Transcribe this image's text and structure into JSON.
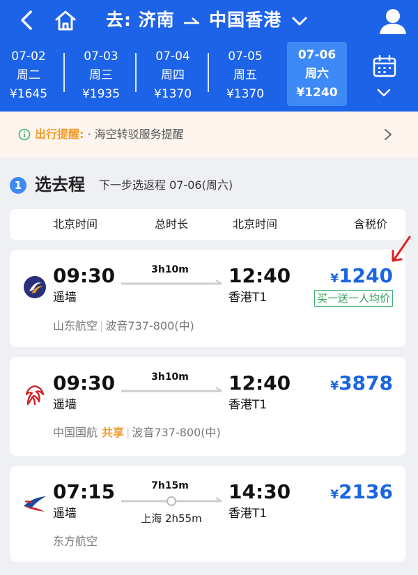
{
  "header": {
    "title_prefix": "去:",
    "origin": "济南",
    "destination": "中国香港",
    "colors": {
      "bg": "#1d63e8",
      "active_date": "#3d8af7"
    }
  },
  "dates": [
    {
      "date": "07-02",
      "weekday": "周二",
      "price": "¥1645",
      "active": false
    },
    {
      "date": "07-03",
      "weekday": "周三",
      "price": "¥1935",
      "active": false
    },
    {
      "date": "07-04",
      "weekday": "周四",
      "price": "¥1370",
      "active": false
    },
    {
      "date": "07-05",
      "weekday": "周五",
      "price": "¥1370",
      "active": false
    },
    {
      "date": "07-06",
      "weekday": "周六",
      "price": "¥1240",
      "active": true
    }
  ],
  "notice": {
    "label": "出行提醒:",
    "text": "· 海空转驳服务提醒"
  },
  "step": {
    "number": "1",
    "title": "选去程",
    "subtitle": "下一步选返程 07-06(周六)"
  },
  "columns": {
    "dep": "北京时间",
    "duration": "总时长",
    "arr": "北京时间",
    "price": "含税价"
  },
  "flights": [
    {
      "dep_time": "09:30",
      "dep_airport": "遥墙",
      "duration": "3h10m",
      "arr_time": "12:40",
      "arr_airport": "香港T1",
      "currency": "¥",
      "price": "1240",
      "tag": "买一送一人均价",
      "airline": "山东航空",
      "aircraft": "波音737-800(中)",
      "logo": "shandong-airlines-logo"
    },
    {
      "dep_time": "09:30",
      "dep_airport": "遥墙",
      "duration": "3h10m",
      "arr_time": "12:40",
      "arr_airport": "香港T1",
      "currency": "¥",
      "price": "3878",
      "airline": "中国国航",
      "share": "共享",
      "aircraft": "波音737-800(中)",
      "logo": "air-china-logo"
    },
    {
      "dep_time": "07:15",
      "dep_airport": "遥墙",
      "duration": "7h15m",
      "stop": "上海 2h55m",
      "arr_time": "14:30",
      "arr_airport": "香港T1",
      "currency": "¥",
      "price": "2136",
      "airline": "东方航空",
      "logo": "china-eastern-logo"
    }
  ],
  "colors": {
    "price": "#1a66e0",
    "tag": "#2e9f56",
    "share": "#f39c2d",
    "annotation": "#e02020"
  }
}
